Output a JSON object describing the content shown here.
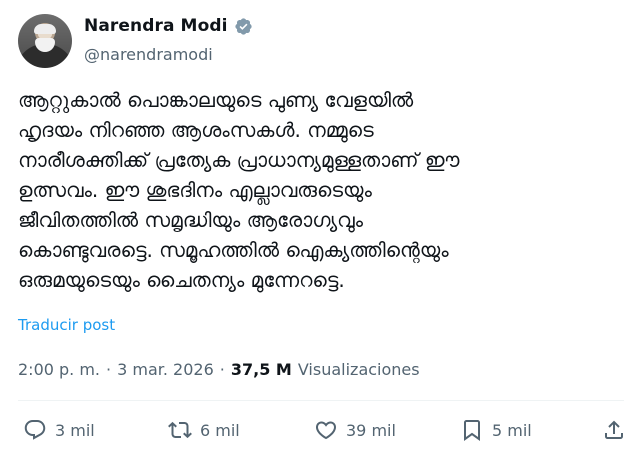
{
  "author": {
    "name": "Narendra Modi",
    "handle": "@narendramodi"
  },
  "tweet": {
    "text": "ആറ്റുകാൽ പൊങ്കാലയുടെ പുണ്യ വേളയിൽ\nഹൃദയം നിറഞ്ഞ ആശംസകൾ. നമ്മുടെ\nനാരീശക്തിക്ക് പ്രത്യേക പ്രാധാന്യമുള്ളതാണ് ഈ\nഉത്സവം. ഈ ശുഭദിനം എല്ലാവരുടെയും\nജീവിതത്തിൽ സമൃദ്ധിയും ആരോഗ്യവും\nകൊണ്ടുവരട്ടെ. സമൂഹത്തിൽ ഐക്യത്തിന്റെയും\nഒരുമയുടെയും ചൈതന്യം മുന്നേറട്ടെ.",
    "translate_label": "Traducir post"
  },
  "meta": {
    "time": "2:00 p. m.",
    "separator": "·",
    "date": "3 mar. 2026",
    "separator2": "·",
    "views_count": "37,5 M",
    "views_label": "Visualizaciones"
  },
  "actions": {
    "replies": "3 mil",
    "reposts": "6 mil",
    "likes": "39 mil",
    "bookmarks": "5 mil"
  },
  "icons": {
    "verified": "verified-badge-icon",
    "reply": "reply-icon",
    "repost": "repost-icon",
    "like": "heart-icon",
    "bookmark": "bookmark-icon",
    "share": "share-icon"
  },
  "colors": {
    "accent": "#1d9bf0",
    "secondary_text": "#536471"
  }
}
